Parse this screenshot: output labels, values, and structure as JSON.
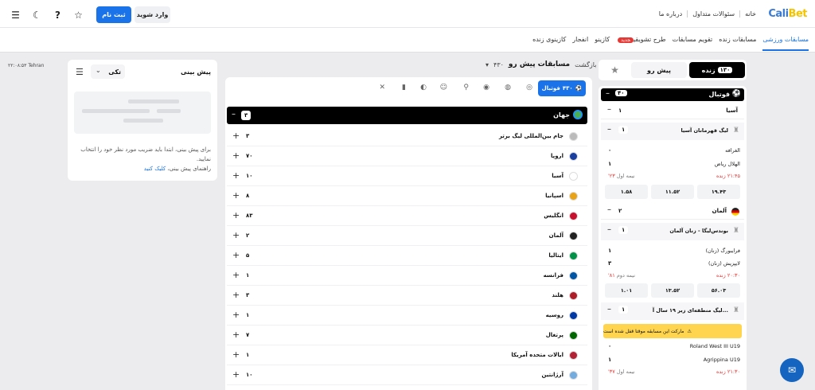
{
  "header": {
    "logo_main": "Cali",
    "logo_accent": "Bet",
    "nav": [
      "خانه",
      "سئوالات متداول",
      "درباره ما"
    ],
    "register": "ثبت نام",
    "login": "وارد شوید"
  },
  "secnav": {
    "items": [
      "مسابقات ورزشی",
      "مسابقات زنده",
      "تقویم مسابقات",
      "طرح تشویقی",
      "کازینو",
      "انفجار",
      "کازینوی زنده"
    ],
    "new_badge": "جدید",
    "time": "۲۲:۰۸:۵۳",
    "city": "Tehran"
  },
  "prediction": {
    "title": "پیش بینی",
    "select": "تکی",
    "text": "برای پیش بینی، ابتدا باید ضریب مورد نظر خود را انتخاب نمایید.",
    "guide": "راهنمای پیش بینی،",
    "guide_link": "کلیک کنید"
  },
  "crumb": {
    "back": "بازگشت",
    "title": "مسابقات پیش رو",
    "count": "۴۳۰"
  },
  "sport": {
    "label": "فوتبال",
    "count": "۴۳۰"
  },
  "region": {
    "name": "جهان",
    "count": "۳"
  },
  "rows": [
    {
      "name": "جام بین‌المللی لیگ برتر",
      "count": "۳",
      "color": "#bbb"
    },
    {
      "name": "اروپا",
      "count": "۷۰",
      "color": "#1a3fa0"
    },
    {
      "name": "آسیا",
      "count": "۱۰",
      "color": "#fff"
    },
    {
      "name": "اسپانیا",
      "count": "۸",
      "color": "#e8a317"
    },
    {
      "name": "انگلیس",
      "count": "۸۳",
      "color": "#c8102e"
    },
    {
      "name": "آلمان",
      "count": "۲",
      "color": "#222"
    },
    {
      "name": "ایتالیا",
      "count": "۵",
      "color": "#009246"
    },
    {
      "name": "فرانسه",
      "count": "۱",
      "color": "#0055a4"
    },
    {
      "name": "هلند",
      "count": "۳",
      "color": "#ae1c28"
    },
    {
      "name": "روسیه",
      "count": "۱",
      "color": "#0039a6"
    },
    {
      "name": "پرتغال",
      "count": "۷",
      "color": "#006600"
    },
    {
      "name": "ایالات متحده آمریکا",
      "count": "۱",
      "color": "#b22234"
    },
    {
      "name": "آرژانتین",
      "count": "۱۰",
      "color": "#74acdf"
    }
  ],
  "live": {
    "tab_live": "زنده",
    "tab_live_count": "۱۳۰",
    "tab_pre": "پیش رو",
    "sport": "فوتبال",
    "sport_count": "۴۰",
    "asia": "آسیا",
    "asia_count": "۱",
    "league1": "لیگ قهرمانان آسیا",
    "league1_count": "۱",
    "m1_t1": "الغرافه",
    "m1_s1": "۰",
    "m1_t2": "الهلال ریاض",
    "m1_s2": "۱",
    "m1_live": "۲۱:۴۵ زنده",
    "m1_half": "نیمه اول",
    "m1_min": "۲۳'",
    "m1_o1": "۱.۵۸",
    "m1_o2": "۱۱.۵۲",
    "m1_o3": "۱۹.۴۳",
    "germany": "آلمان",
    "germany_count": "۲",
    "league2": "بوندس‌لیگا - زنان آلمان",
    "league2_count": "۱",
    "m2_t1": "فرایبورگ (زنان)",
    "m2_s1": "۱",
    "m2_t2": "لایپزیش (زنان)",
    "m2_s2": "۳",
    "m2_live": "۲۰:۳۰ زنده",
    "m2_half": "نیمه دوم",
    "m2_min": "۸۱'",
    "m2_o1": "۱.۰۱",
    "m2_o2": "۱۳.۵۲",
    "m2_o3": "۵۶.۰۳",
    "league3": "لیگ منطقه‌ای زیر ۱۹ سال آ...",
    "league3_count": "۱",
    "warn": "مارکت این مسابقه موقتا قفل شده است",
    "m3_t1": "Roland West III U19",
    "m3_s1": "۰",
    "m3_t2": "Agrippina U19",
    "m3_s2": "۱",
    "m3_live": "۲۱:۳۰ زنده",
    "m3_half": "نیمه اول",
    "m3_min": "۳۷'"
  }
}
